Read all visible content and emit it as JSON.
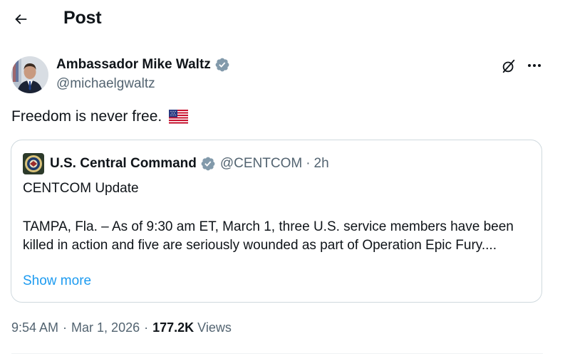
{
  "header": {
    "title": "Post",
    "back_icon": "back-arrow-icon"
  },
  "author": {
    "name": "Ambassador Mike Waltz",
    "handle": "@michaelgwaltz",
    "verified_icon": "verified-badge-icon",
    "verified_color": "#829aab"
  },
  "post": {
    "text": "Freedom is never free.",
    "emoji": "us-flag"
  },
  "quote": {
    "name": "U.S. Central Command",
    "handle": "@CENTCOM",
    "dot": "·",
    "time": "2h",
    "title_line": "CENTCOM Update",
    "body": "TAMPA, Fla. – As of 9:30 am ET, March 1, three U.S. service members have been killed in action and five are seriously wounded as part of Operation Epic Fury....",
    "show_more": "Show more"
  },
  "meta": {
    "time": "9:54 AM",
    "sep": "·",
    "date": "Mar 1, 2026",
    "views_count": "177.2K",
    "views_label": "Views"
  },
  "colors": {
    "link": "#1d9bf0",
    "secondary_text": "#536471",
    "border": "#cfd9de"
  }
}
